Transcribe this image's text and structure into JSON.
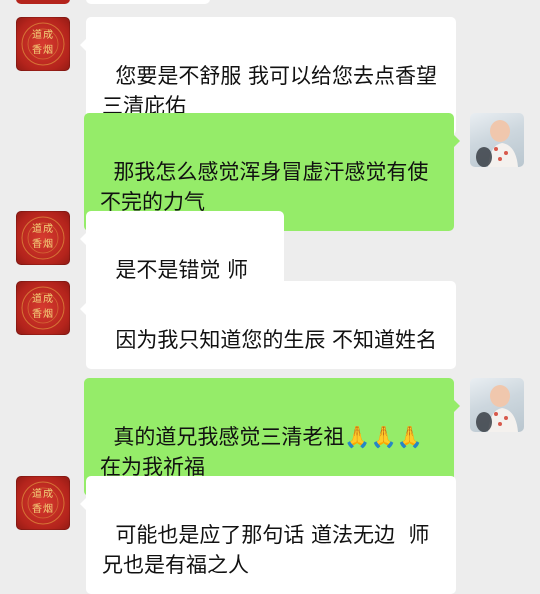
{
  "chat": {
    "messages": [
      {
        "side": "left",
        "text": "您要是不舒服 我可以给您去点香望三清庇佑"
      },
      {
        "side": "right",
        "text": "那我怎么感觉浑身冒虚汗感觉有使不完的力气"
      },
      {
        "side": "left",
        "text": "是不是错觉 师兄"
      },
      {
        "side": "left",
        "text": "因为我只知道您的生辰 不知道姓名"
      },
      {
        "side": "right",
        "text_line1_prefix": "真的道兄我感觉三清老祖",
        "emoji": "🙏🙏🙏",
        "text_line2": "在为我祈福"
      },
      {
        "side": "left",
        "text": "可能也是应了那句话 道法无边  师兄也是有福之人"
      }
    ]
  },
  "avatars": {
    "taoist": {
      "text": "道成\n香烟",
      "icon": "taoist-seal-icon"
    },
    "user": {
      "icon": "baby-photo-icon"
    }
  },
  "colors": {
    "background": "#ededed",
    "incoming_bubble": "#ffffff",
    "outgoing_bubble": "#95ec69",
    "avatar_red": "#b4241c",
    "avatar_gold": "#f3d27a"
  }
}
